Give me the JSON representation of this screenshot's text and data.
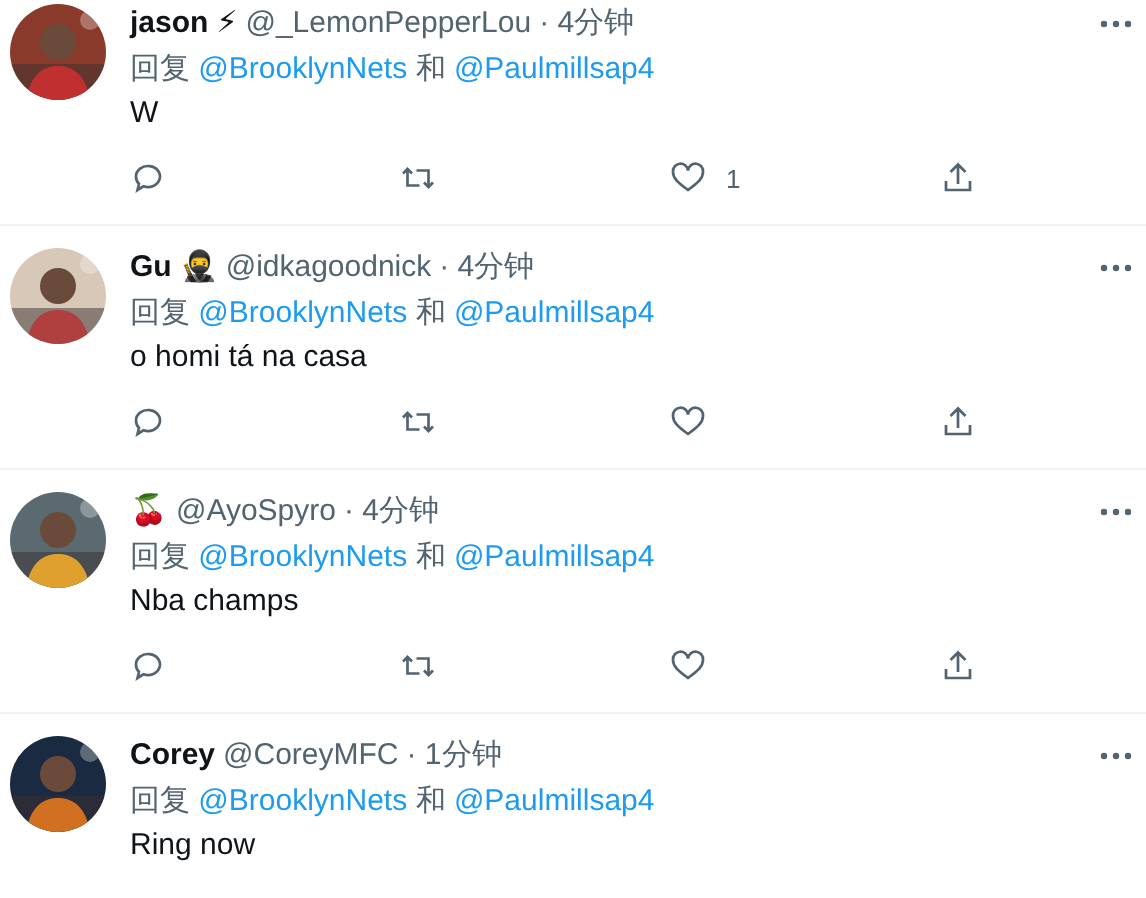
{
  "tweets": [
    {
      "name": "jason",
      "emoji": "⚡",
      "handle": "@_LemonPepperLou",
      "time": "· 4分钟",
      "reply": {
        "prefix": "回复",
        "mentions": [
          "@BrooklynNets",
          "@Paulmillsap4"
        ],
        "joiner": "和"
      },
      "text": "W",
      "actions": [
        {
          "kind": "reply"
        },
        {
          "kind": "retweet"
        },
        {
          "kind": "like",
          "count": "1"
        },
        {
          "kind": "share"
        }
      ]
    },
    {
      "name": "Gu",
      "emoji": "🥷",
      "handle": "@idkagoodnick",
      "time": "· 4分钟",
      "reply": {
        "prefix": "回复",
        "mentions": [
          "@BrooklynNets",
          "@Paulmillsap4"
        ],
        "joiner": "和"
      },
      "text": "o homi tá na casa",
      "actions": [
        {
          "kind": "reply"
        },
        {
          "kind": "retweet"
        },
        {
          "kind": "like"
        },
        {
          "kind": "share"
        }
      ]
    },
    {
      "emoji": "🍒",
      "handle": "@AyoSpyro",
      "time": "· 4分钟",
      "reply": {
        "prefix": "回复",
        "mentions": [
          "@BrooklynNets",
          "@Paulmillsap4"
        ],
        "joiner": "和"
      },
      "text": "Nba champs",
      "actions": [
        {
          "kind": "reply"
        },
        {
          "kind": "retweet"
        },
        {
          "kind": "like"
        },
        {
          "kind": "share"
        }
      ]
    },
    {
      "name": "Corey",
      "handle": "@CoreyMFC",
      "time": "· 1分钟",
      "reply": {
        "prefix": "回复",
        "mentions": [
          "@BrooklynNets",
          "@Paulmillsap4"
        ],
        "joiner": "和"
      },
      "text": "Ring now"
    }
  ]
}
